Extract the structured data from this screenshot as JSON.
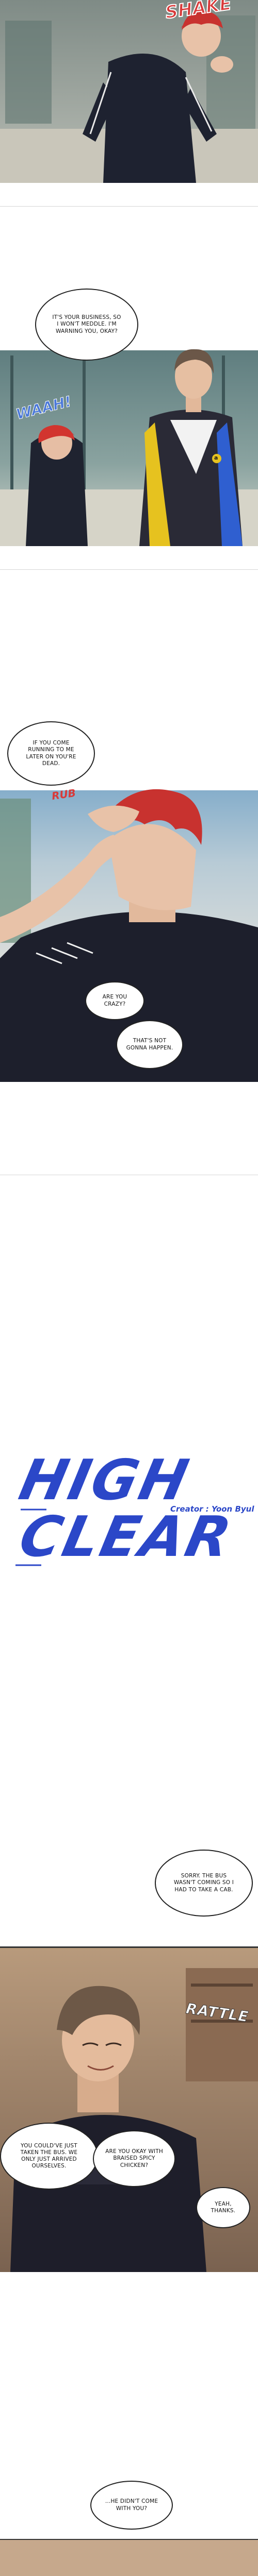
{
  "panels": {
    "p1": {
      "sfx": "SHAKE"
    },
    "p2": {
      "bubble_main": "IT'S YOUR BUSINESS, SO I WON'T MEDDLE. I'M WARNING YOU, OKAY?",
      "sfx": "WAAH!",
      "vest_logo": "a"
    },
    "p3": {
      "bubble_top": "IF YOU COME RUNNING TO ME LATER ON YOU'RE DEAD.",
      "sfx": "RUB",
      "bubble_crazy": "ARE YOU CRAZY?",
      "bubble_never": "THAT'S NOT GONNA HAPPEN."
    },
    "title": {
      "line1": "HIGH",
      "line2": "CLEAR",
      "credit": "Creator : Yoon Byul"
    },
    "p4": {
      "bubble_sorry": "SORRY. THE BUS WASN'T COMING SO I HAD TO TAKE A CAB.",
      "sfx": "RATTLE",
      "bubble_bus": "YOU COULD'VE JUST TAKEN THE BUS. WE ONLY JUST ARRIVED OURSELVES.",
      "bubble_okay": "ARE YOU OKAY WITH BRAISED SPICY CHICKEN?",
      "bubble_thanks": "YEAH, THANKS."
    },
    "p5": {
      "bubble_why": "...HE DIDN'T COME WITH YOU?"
    }
  },
  "colors": {
    "title_blue": "#2b47c8",
    "hair_red": "#c8322f",
    "sfx_blue": "#4a78d8",
    "vest_yellow": "#e6c21f",
    "vest_blue": "#2f5fd0"
  }
}
